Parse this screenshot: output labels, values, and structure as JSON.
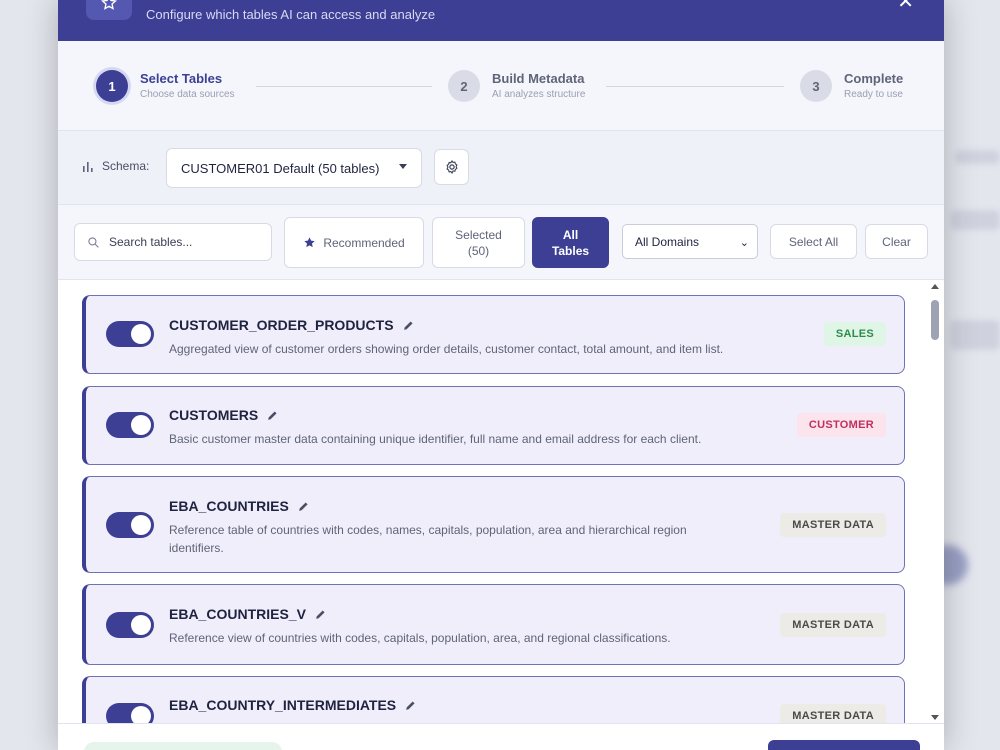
{
  "header": {
    "subtitle": "Configure which tables AI can access and analyze",
    "close_symbol": "✕"
  },
  "stepper": {
    "steps": [
      {
        "number": "1",
        "title": "Select Tables",
        "subtitle": "Choose data sources",
        "state": "active"
      },
      {
        "number": "2",
        "title": "Build Metadata",
        "subtitle": "AI analyzes structure",
        "state": "inactive"
      },
      {
        "number": "3",
        "title": "Complete",
        "subtitle": "Ready to use",
        "state": "inactive"
      }
    ]
  },
  "schema": {
    "label": "Schema:",
    "selected": "CUSTOMER01 Default (50 tables)"
  },
  "filters": {
    "search_placeholder": "Search tables...",
    "recommended_label": "Recommended",
    "selected_label": "Selected",
    "selected_count": "(50)",
    "all_tables_line1": "All",
    "all_tables_line2": "Tables",
    "domain_selected": "All Domains",
    "select_all_label": "Select All",
    "clear_label": "Clear"
  },
  "tables": [
    {
      "name": "CUSTOMER_ORDER_PRODUCTS",
      "description": "Aggregated view of customer orders showing order details, customer contact, total amount, and item list.",
      "tag": "SALES",
      "tag_style": "sales",
      "enabled": true
    },
    {
      "name": "CUSTOMERS",
      "description": "Basic customer master data containing unique identifier, full name and email address for each client.",
      "tag": "CUSTOMER",
      "tag_style": "customer",
      "enabled": true
    },
    {
      "name": "EBA_COUNTRIES",
      "description": "Reference table of countries with codes, names, capitals, population, area and hierarchical region identifiers.",
      "tag": "MASTER DATA",
      "tag_style": "master",
      "enabled": true
    },
    {
      "name": "EBA_COUNTRIES_V",
      "description": "Reference view of countries with codes, capitals, population, area, and regional classifications.",
      "tag": "MASTER DATA",
      "tag_style": "master",
      "enabled": true
    },
    {
      "name": "EBA_COUNTRY_INTERMEDIATES",
      "description": "",
      "tag": "MASTER DATA",
      "tag_style": "master",
      "enabled": true
    }
  ],
  "colors": {
    "primary": "#3c3f93",
    "sales_tag": "#2e8a4e",
    "customer_tag": "#c0305f"
  }
}
